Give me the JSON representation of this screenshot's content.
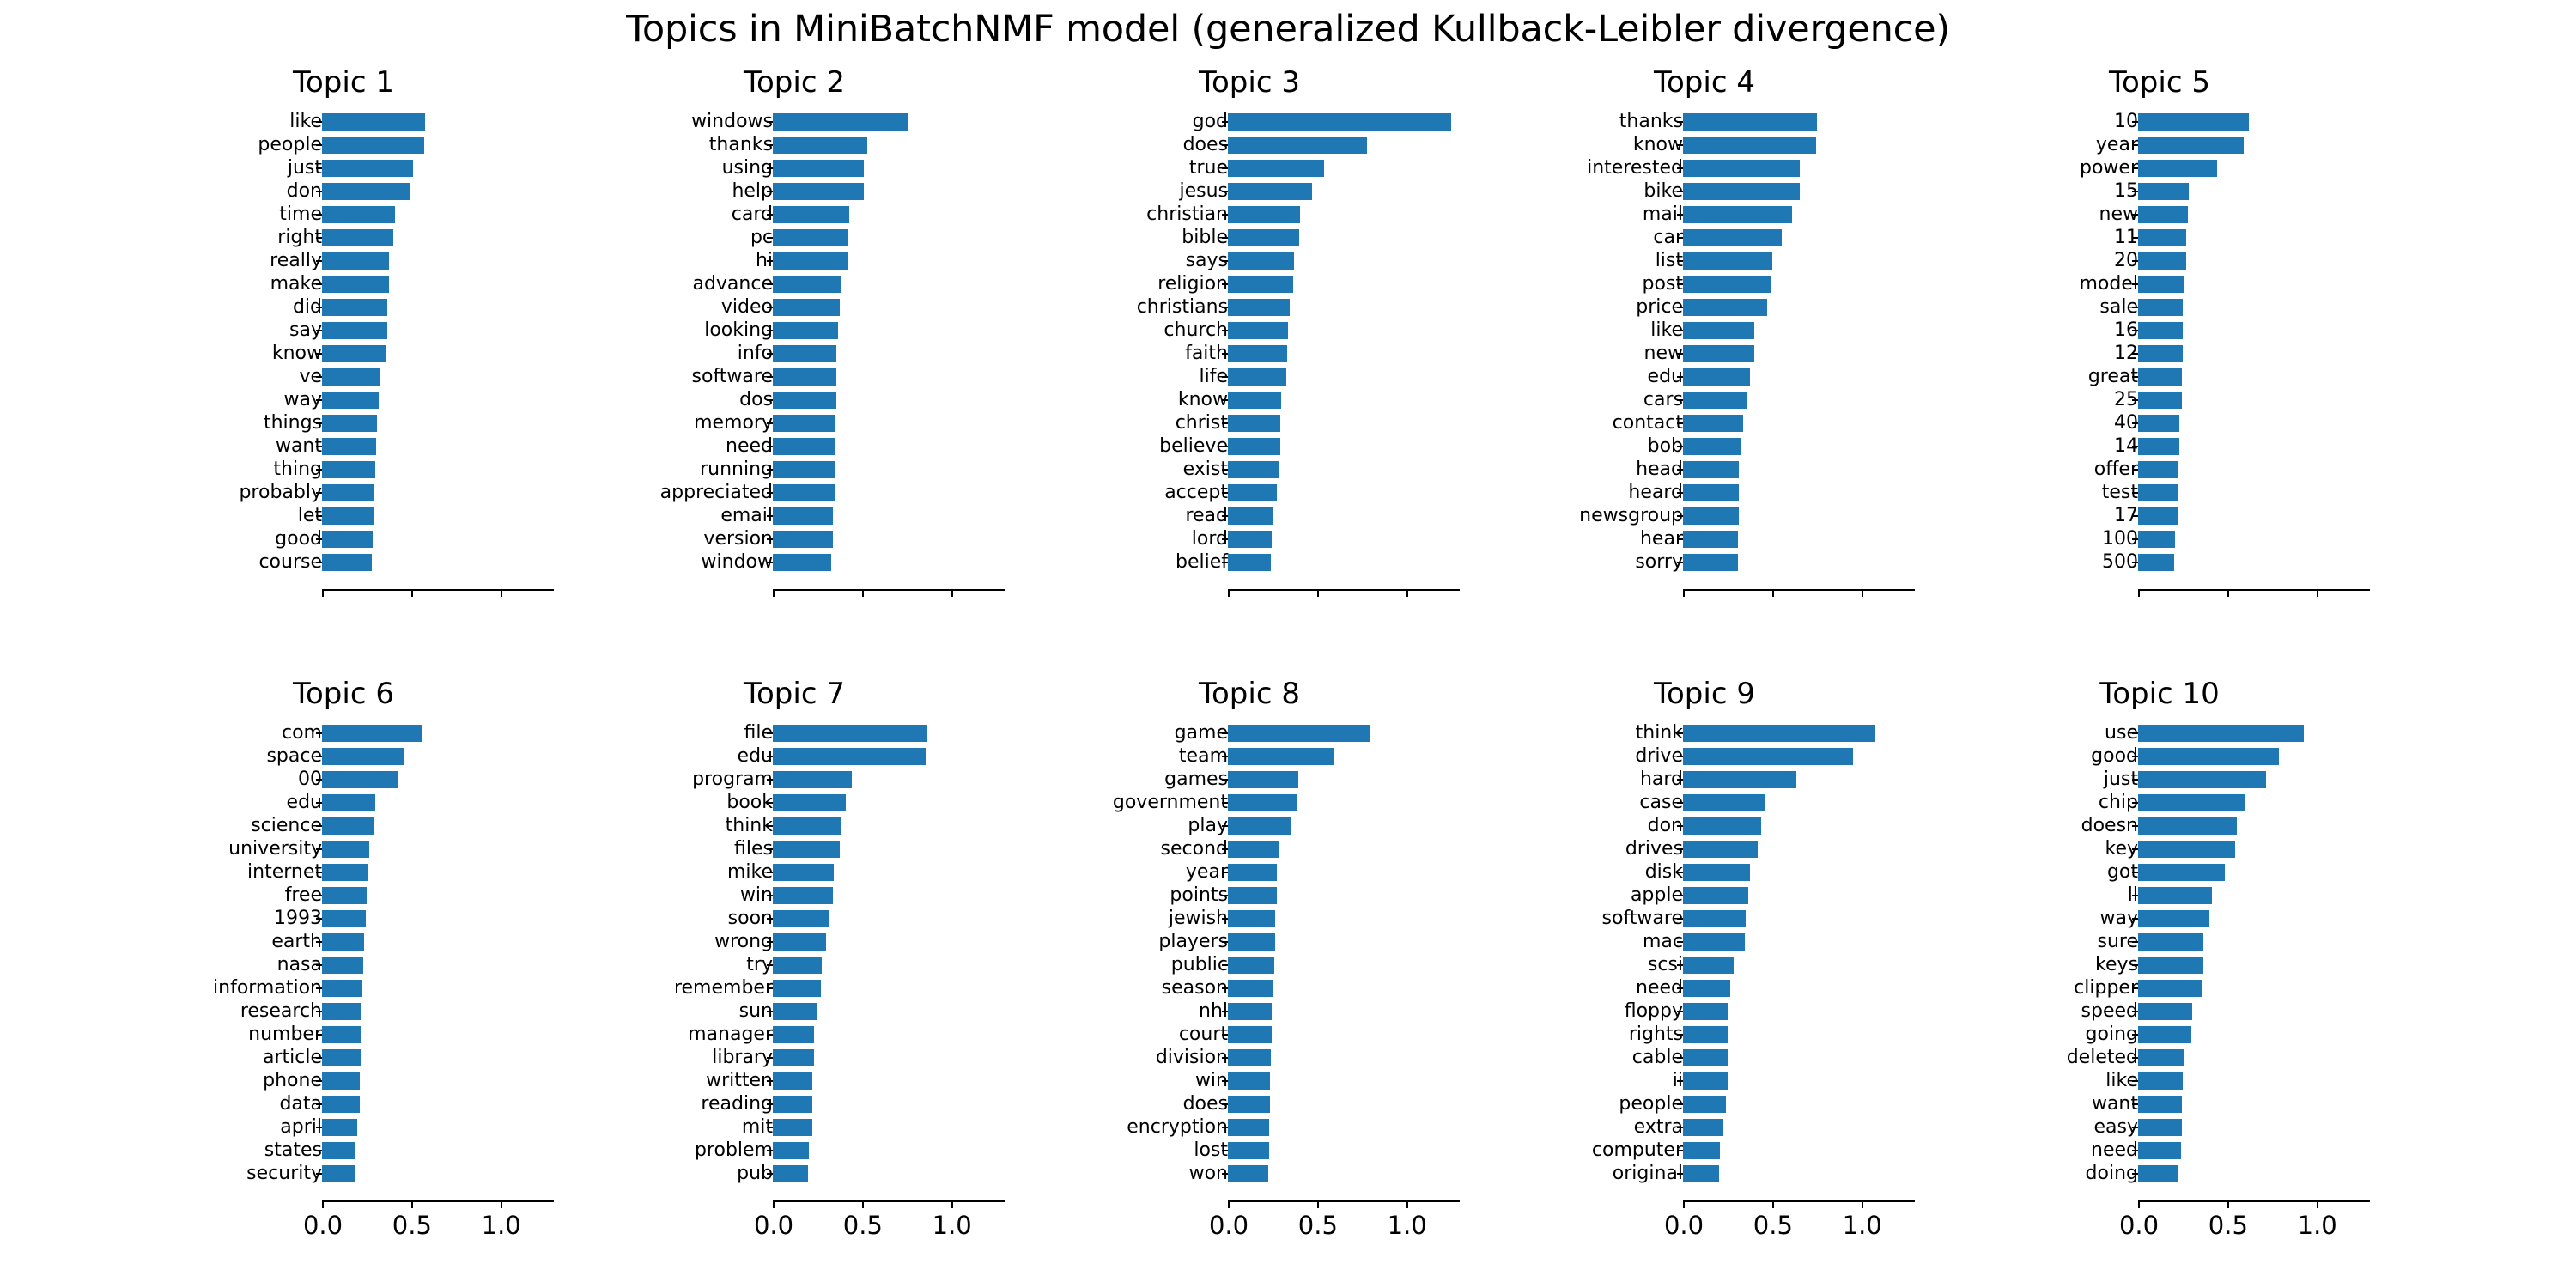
{
  "figure": {
    "suptitle": "Topics in MiniBatchNMF model (generalized Kullback-Leibler divergence)",
    "bar_color": "#1f77b4",
    "background_color": "#ffffff",
    "text_color": "#000000",
    "rows": 2,
    "columns": 5
  },
  "axis": {
    "tick_labels": [
      "0.0",
      "0.5",
      "1.0"
    ],
    "tick_values": [
      0.0,
      0.5,
      1.0
    ],
    "xlim": [
      0.0,
      1.3
    ],
    "top_row_tick_labels_visible": false,
    "bottom_row_tick_labels_visible": true
  },
  "chart_data": {
    "type": "bar",
    "orientation": "horizontal",
    "title": "Topics in MiniBatchNMF model (generalized Kullback-Leibler divergence)",
    "xlabel": "",
    "ylabel": "",
    "xlim": [
      0.0,
      1.3
    ],
    "xticks": [
      0.0,
      0.5,
      1.0
    ],
    "grid": false,
    "legend": "none",
    "color": "#1f77b4",
    "panels": [
      {
        "title": "Topic 1",
        "categories": [
          "like",
          "people",
          "just",
          "don",
          "time",
          "right",
          "really",
          "make",
          "did",
          "say",
          "know",
          "ve",
          "way",
          "things",
          "want",
          "thing",
          "probably",
          "let",
          "good",
          "course"
        ],
        "values": [
          0.58,
          0.575,
          0.51,
          0.495,
          0.41,
          0.4,
          0.375,
          0.375,
          0.365,
          0.365,
          0.355,
          0.325,
          0.32,
          0.31,
          0.305,
          0.3,
          0.295,
          0.29,
          0.285,
          0.28
        ]
      },
      {
        "title": "Topic 2",
        "categories": [
          "windows",
          "thanks",
          "using",
          "help",
          "card",
          "pc",
          "hi",
          "advance",
          "video",
          "looking",
          "info",
          "software",
          "dos",
          "memory",
          "need",
          "running",
          "appreciated",
          "email",
          "version",
          "window"
        ],
        "values": [
          0.76,
          0.53,
          0.51,
          0.51,
          0.43,
          0.42,
          0.42,
          0.385,
          0.375,
          0.365,
          0.355,
          0.355,
          0.355,
          0.35,
          0.345,
          0.345,
          0.345,
          0.335,
          0.335,
          0.325
        ]
      },
      {
        "title": "Topic 3",
        "categories": [
          "god",
          "does",
          "true",
          "jesus",
          "christian",
          "bible",
          "says",
          "religion",
          "christians",
          "church",
          "faith",
          "life",
          "know",
          "christ",
          "believe",
          "exist",
          "accept",
          "read",
          "lord",
          "belief"
        ],
        "values": [
          1.25,
          0.78,
          0.54,
          0.47,
          0.405,
          0.4,
          0.37,
          0.365,
          0.345,
          0.335,
          0.33,
          0.325,
          0.3,
          0.295,
          0.295,
          0.29,
          0.275,
          0.25,
          0.245,
          0.24
        ]
      },
      {
        "title": "Topic 4",
        "categories": [
          "thanks",
          "know",
          "interested",
          "bike",
          "mail",
          "car",
          "list",
          "post",
          "price",
          "like",
          "new",
          "edu",
          "cars",
          "contact",
          "bob",
          "head",
          "heard",
          "newsgroup",
          "hear",
          "sorry"
        ],
        "values": [
          0.75,
          0.745,
          0.655,
          0.655,
          0.61,
          0.555,
          0.5,
          0.495,
          0.47,
          0.4,
          0.4,
          0.375,
          0.36,
          0.335,
          0.325,
          0.315,
          0.315,
          0.315,
          0.31,
          0.31
        ]
      },
      {
        "title": "Topic 5",
        "categories": [
          "10",
          "year",
          "power",
          "15",
          "new",
          "11",
          "20",
          "model",
          "sale",
          "16",
          "12",
          "great",
          "25",
          "40",
          "14",
          "offer",
          "test",
          "17",
          "100",
          "500"
        ],
        "values": [
          0.62,
          0.59,
          0.445,
          0.285,
          0.28,
          0.27,
          0.27,
          0.255,
          0.25,
          0.25,
          0.25,
          0.245,
          0.245,
          0.23,
          0.23,
          0.225,
          0.22,
          0.22,
          0.205,
          0.2
        ]
      },
      {
        "title": "Topic 6",
        "categories": [
          "com",
          "space",
          "00",
          "edu",
          "science",
          "university",
          "internet",
          "free",
          "1993",
          "earth",
          "nasa",
          "information",
          "research",
          "number",
          "article",
          "phone",
          "data",
          "april",
          "states",
          "security"
        ],
        "values": [
          0.565,
          0.455,
          0.425,
          0.3,
          0.29,
          0.265,
          0.255,
          0.25,
          0.245,
          0.235,
          0.23,
          0.225,
          0.22,
          0.22,
          0.215,
          0.21,
          0.21,
          0.195,
          0.19,
          0.19
        ]
      },
      {
        "title": "Topic 7",
        "categories": [
          "file",
          "edu",
          "program",
          "book",
          "think",
          "files",
          "mike",
          "win",
          "soon",
          "wrong",
          "try",
          "remember",
          "sun",
          "manager",
          "library",
          "written",
          "reading",
          "mit",
          "problem",
          "pub"
        ],
        "values": [
          0.86,
          0.855,
          0.445,
          0.41,
          0.385,
          0.375,
          0.34,
          0.335,
          0.315,
          0.3,
          0.275,
          0.27,
          0.245,
          0.23,
          0.23,
          0.22,
          0.22,
          0.22,
          0.2,
          0.195
        ]
      },
      {
        "title": "Topic 8",
        "categories": [
          "game",
          "team",
          "games",
          "government",
          "play",
          "second",
          "year",
          "points",
          "jewish",
          "players",
          "public",
          "season",
          "nhl",
          "court",
          "division",
          "win",
          "does",
          "encryption",
          "lost",
          "won"
        ],
        "values": [
          0.795,
          0.595,
          0.395,
          0.385,
          0.355,
          0.29,
          0.275,
          0.275,
          0.265,
          0.265,
          0.26,
          0.25,
          0.245,
          0.245,
          0.24,
          0.235,
          0.235,
          0.23,
          0.23,
          0.225
        ]
      },
      {
        "title": "Topic 9",
        "categories": [
          "think",
          "drive",
          "hard",
          "case",
          "don",
          "drives",
          "disk",
          "apple",
          "software",
          "mac",
          "scsi",
          "need",
          "floppy",
          "rights",
          "cable",
          "ii",
          "people",
          "extra",
          "computer",
          "original"
        ],
        "values": [
          1.08,
          0.955,
          0.635,
          0.46,
          0.44,
          0.42,
          0.375,
          0.365,
          0.35,
          0.345,
          0.285,
          0.265,
          0.255,
          0.255,
          0.25,
          0.25,
          0.24,
          0.225,
          0.205,
          0.2
        ]
      },
      {
        "title": "Topic 10",
        "categories": [
          "use",
          "good",
          "just",
          "chip",
          "doesn",
          "key",
          "got",
          "ll",
          "way",
          "sure",
          "keys",
          "clipper",
          "speed",
          "going",
          "deleted",
          "like",
          "want",
          "easy",
          "need",
          "doing"
        ],
        "values": [
          0.93,
          0.79,
          0.715,
          0.6,
          0.555,
          0.545,
          0.485,
          0.415,
          0.4,
          0.365,
          0.365,
          0.36,
          0.305,
          0.3,
          0.26,
          0.25,
          0.245,
          0.245,
          0.24,
          0.225
        ]
      }
    ]
  }
}
